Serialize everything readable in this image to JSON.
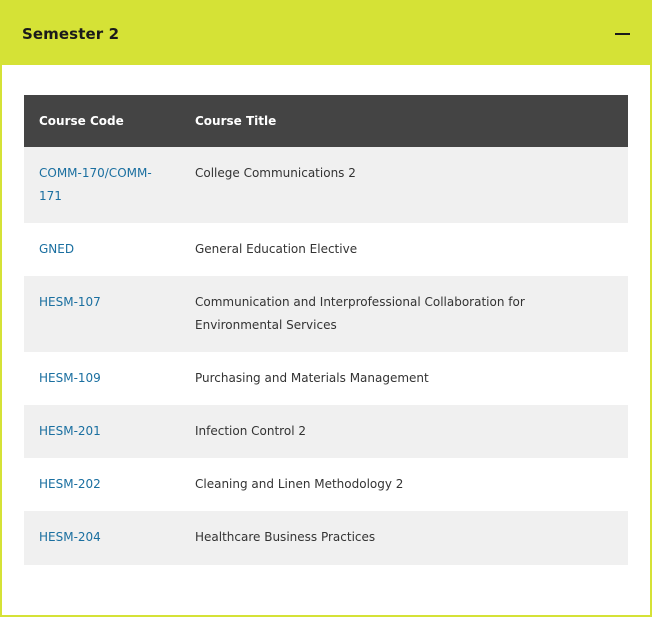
{
  "header": {
    "title": "Semester 2",
    "toggle_icon": "minus-icon"
  },
  "colors": {
    "accent": "#d5e236",
    "table_header_bg": "#444444",
    "row_alt_bg": "#f0f0f0",
    "link": "#1a6fa0"
  },
  "table": {
    "columns": [
      "Course Code",
      "Course Title"
    ],
    "rows": [
      {
        "code": "COMM-170/COMM-171",
        "title": "College Communications 2"
      },
      {
        "code": "GNED",
        "title": "General Education Elective"
      },
      {
        "code": "HESM-107",
        "title": "Communication and Interprofessional Collaboration for Environmental Services"
      },
      {
        "code": "HESM-109",
        "title": "Purchasing and Materials Management"
      },
      {
        "code": "HESM-201",
        "title": "Infection Control 2"
      },
      {
        "code": "HESM-202",
        "title": "Cleaning and Linen Methodology 2"
      },
      {
        "code": "HESM-204",
        "title": "Healthcare Business Practices"
      }
    ]
  }
}
